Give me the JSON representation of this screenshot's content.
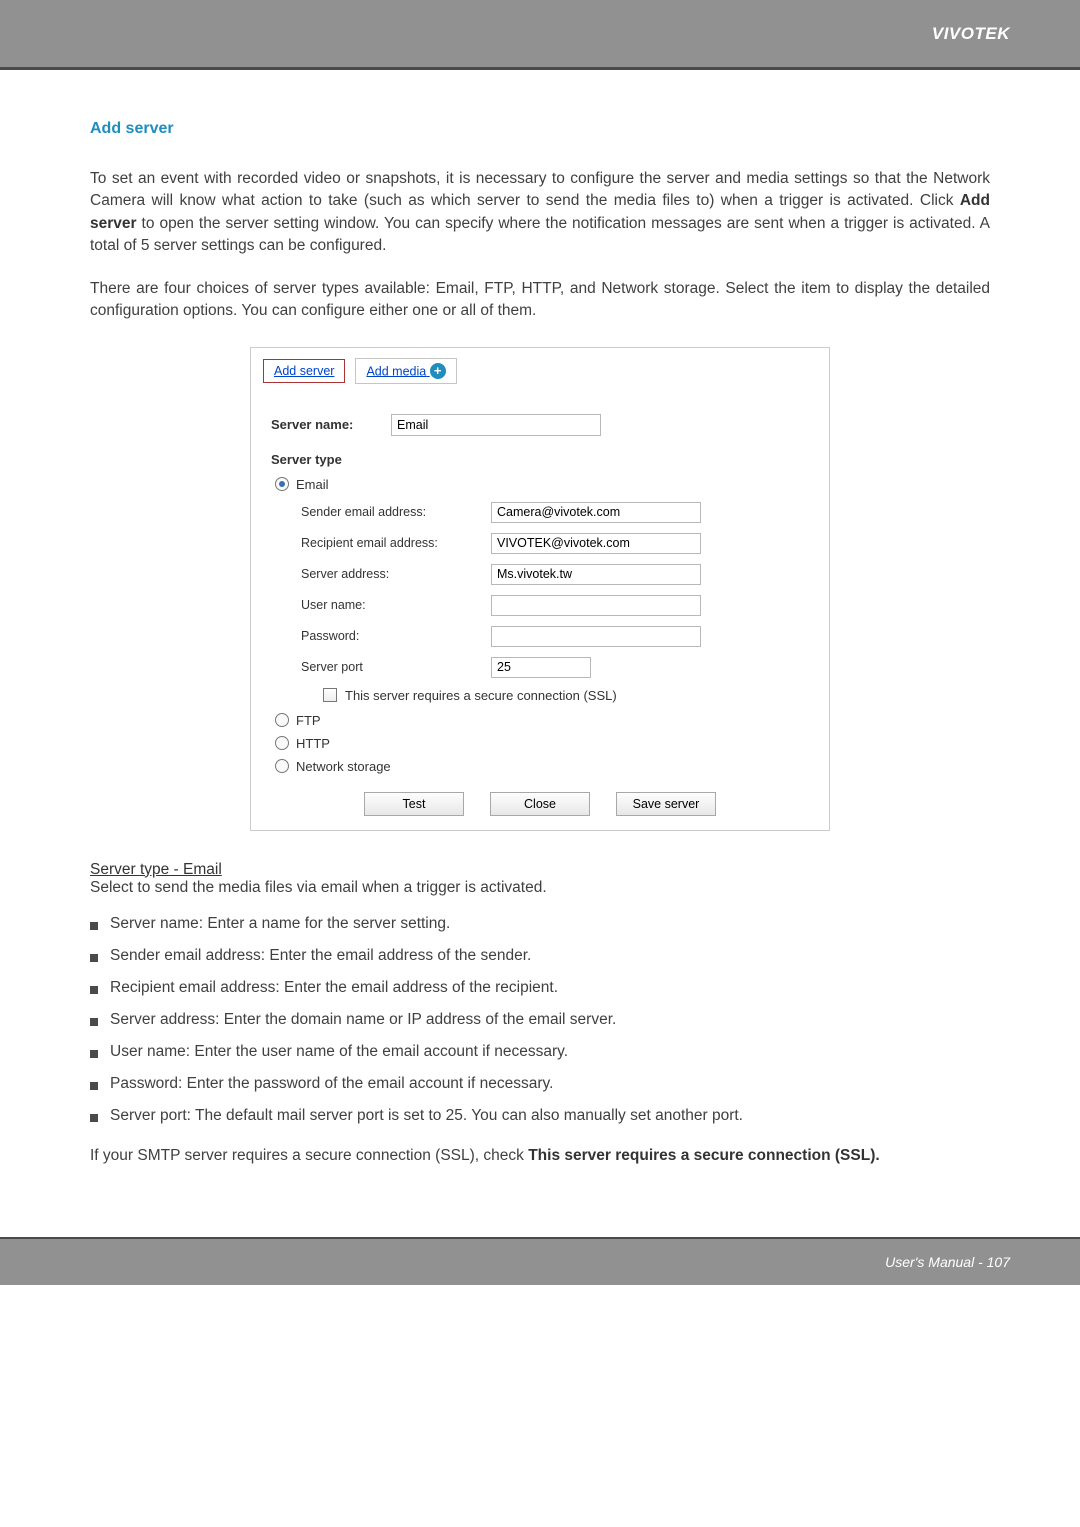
{
  "header": {
    "brand": "VIVOTEK"
  },
  "section": {
    "title": "Add server",
    "p1_a": "To set an event with recorded video or snapshots, it is necessary to configure the server and media settings so that the Network Camera will know what action to take (such as which server to send the media files to) when a trigger is activated. Click ",
    "p1_b_bold": "Add server",
    "p1_c": " to open the server setting window. You can specify where the notification messages are sent when a trigger is activated. A total of 5 server settings can be configured.",
    "p2": "There are four choices of server types available: Email, FTP, HTTP, and Network storage. Select the item to display the detailed configuration options. You can configure either one or all of them."
  },
  "shot": {
    "tabs": {
      "add_server": "Add server",
      "add_media": "Add media"
    },
    "server_name_label": "Server name:",
    "server_name_value": "Email",
    "server_type_heading": "Server type",
    "radios": {
      "email": "Email",
      "ftp": "FTP",
      "http": "HTTP",
      "network_storage": "Network storage"
    },
    "fields": {
      "sender_label": "Sender email address:",
      "sender_value": "Camera@vivotek.com",
      "recipient_label": "Recipient email address:",
      "recipient_value": "VIVOTEK@vivotek.com",
      "server_address_label": "Server address:",
      "server_address_value": "Ms.vivotek.tw",
      "username_label": "User name:",
      "username_value": "",
      "password_label": "Password:",
      "password_value": "",
      "port_label": "Server port",
      "port_value": "25",
      "ssl_label": "This server requires a secure connection (SSL)"
    },
    "buttons": {
      "test": "Test",
      "close": "Close",
      "save": "Save server"
    }
  },
  "followup": {
    "subhead": "Server type - Email",
    "desc": "Select to send the media files via email when a trigger is activated.",
    "bullets": [
      "Server name: Enter a name for the server setting.",
      "Sender email address: Enter the email address of the sender.",
      "Recipient email address: Enter the email address of the recipient.",
      "Server address: Enter the domain name or IP address of the email server.",
      "User name: Enter the user name of the email account if necessary.",
      "Password: Enter the password of the email account if necessary.",
      "Server port: The default mail server port is set to 25. You can also manually set another port."
    ],
    "ssl_note_a": "If your SMTP server requires a secure connection (SSL), check ",
    "ssl_note_b_bold": "This server requires a secure connection (SSL)."
  },
  "footer": {
    "text": "User's Manual - 107"
  }
}
